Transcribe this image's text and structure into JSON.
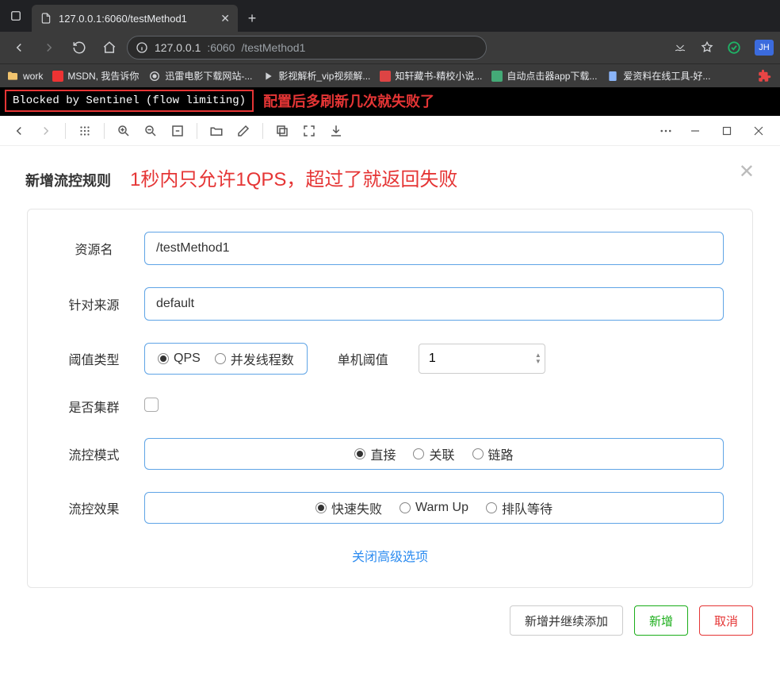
{
  "browser": {
    "tab_title": "127.0.0.1:6060/testMethod1",
    "url_host": "127.0.0.1",
    "url_port": ":6060",
    "url_path": "/testMethod1",
    "avatar": "JH"
  },
  "bookmarks": [
    "work",
    "MSDN, 我告诉你",
    "迅雷电影下载网站-...",
    "影视解析_vip视频解...",
    "知轩藏书-精校小说...",
    "自动点击器app下载...",
    "爱资料在线工具-好..."
  ],
  "sentinel_msg": "Blocked by Sentinel (flow limiting)",
  "refresh_note": "配置后多刷新几次就失败了",
  "modal": {
    "title": "新增流控规则",
    "note": "1秒内只允许1QPS，超过了就返回失败",
    "labels": {
      "resource": "资源名",
      "source": "针对来源",
      "threshold_type": "阈值类型",
      "single_threshold": "单机阈值",
      "cluster": "是否集群",
      "mode": "流控模式",
      "effect": "流控效果"
    },
    "values": {
      "resource": "/testMethod1",
      "source": "default",
      "threshold": "1"
    },
    "options": {
      "threshold_type": [
        "QPS",
        "并发线程数"
      ],
      "mode": [
        "直接",
        "关联",
        "链路"
      ],
      "effect": [
        "快速失败",
        "Warm Up",
        "排队等待"
      ]
    },
    "adv_link": "关闭高级选项",
    "buttons": {
      "add_continue": "新增并继续添加",
      "add": "新增",
      "cancel": "取消"
    }
  }
}
